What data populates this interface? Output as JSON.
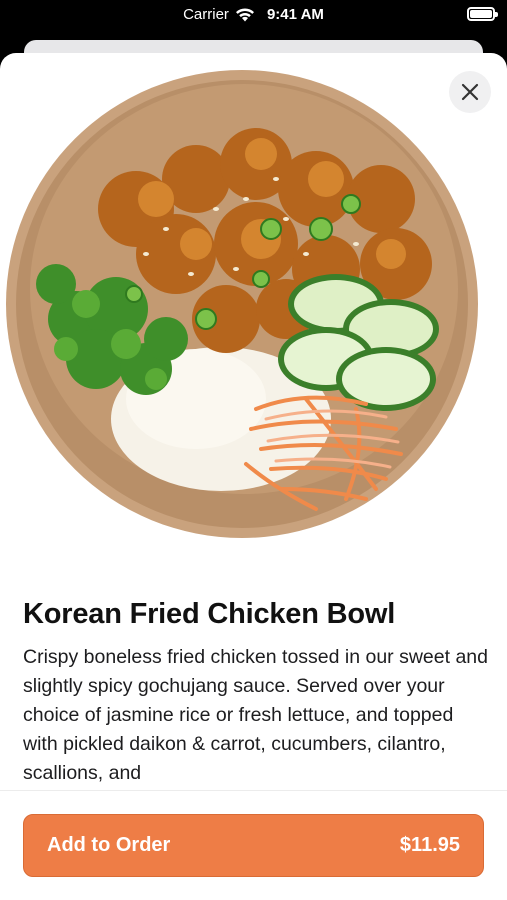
{
  "status_bar": {
    "carrier": "Carrier",
    "time": "9:41 AM",
    "wifi_icon": "wifi-icon",
    "battery_icon": "battery-icon"
  },
  "modal": {
    "close_icon": "close-icon",
    "image": "food-bowl-image",
    "title": "Korean Fried Chicken Bowl",
    "description": "Crispy boneless fried chicken tossed in our sweet and slightly spicy gochujang sauce. Served over your choice of jasmine rice or fresh lettuce, and topped with pickled daikon & carrot, cucumbers, cilantro, scallions, and",
    "order_button": {
      "label": "Add to Order",
      "price": "$11.95"
    }
  },
  "colors": {
    "accent": "#ee7d46",
    "bowl": "#c9a27d"
  }
}
